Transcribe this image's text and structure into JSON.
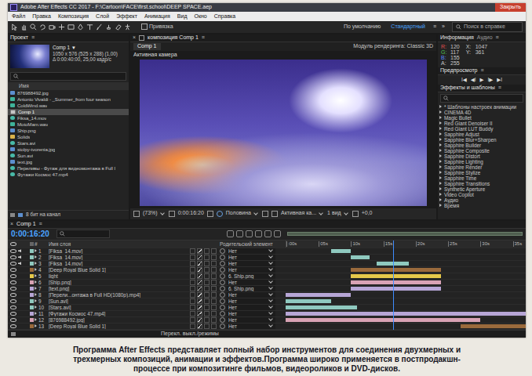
{
  "window": {
    "title": "Adobe After Effects CC 2017 - F:\\Cartoon\\FACE\\first.school\\DEEP SPACE.aep",
    "close_button": "Закрыть"
  },
  "menu": [
    "Файл",
    "Правка",
    "Композиция",
    "Слой",
    "Эффект",
    "Анимация",
    "Вид",
    "Окно",
    "Справка"
  ],
  "toolbar": {
    "snap": {
      "label": "Привязка",
      "checked": false
    },
    "workspaces": [
      {
        "label": "По умолчанию",
        "selected": false
      },
      {
        "label": "Стандартный",
        "selected": true
      }
    ],
    "menu_icon": "≡",
    "more": "»",
    "help_search": "Поиск в справке"
  },
  "project": {
    "title": "Проект",
    "menu_icon": "≡",
    "comp_name": "Comp 1 ▼",
    "comp_size": "1050 x 576 (525 x 288) (1,00)",
    "comp_duration": "Δ 0:00:40:00, 25,00 кадр/с",
    "column": "Имя",
    "items": [
      {
        "name": "876988492.jpg",
        "kind": "image",
        "selected": false
      },
      {
        "name": "Antonio Vivaldi - _Summer_from four season",
        "kind": "audio",
        "selected": false
      },
      {
        "name": "ColdWind.wav",
        "kind": "audio",
        "selected": false
      },
      {
        "name": "Comp 1",
        "kind": "comp",
        "selected": true
      },
      {
        "name": "Fiksa_14.mov",
        "kind": "video",
        "selected": false
      },
      {
        "name": "MotoMam.wav",
        "kind": "audio",
        "selected": false
      },
      {
        "name": "Ship.png",
        "kind": "image",
        "selected": false
      },
      {
        "name": "Solids",
        "kind": "folder",
        "selected": false
      },
      {
        "name": "Stars.avi",
        "kind": "video",
        "selected": false
      },
      {
        "name": "stolpy-tvorenia.jpg",
        "kind": "image",
        "selected": false
      },
      {
        "name": "Sun.avi",
        "kind": "video",
        "selected": false
      },
      {
        "name": "text.jpg",
        "kind": "image",
        "selected": false
      },
      {
        "name": "Переливы - Футаж для видеомонтажа в Full I",
        "kind": "video",
        "selected": false
      },
      {
        "name": "Футажи Космос 47.mp4",
        "kind": "video",
        "selected": false
      }
    ],
    "footer": "8 бит на канал"
  },
  "composition": {
    "close": "×",
    "title": "композиция Comp 1",
    "menu_icon": "≡",
    "tab": "Comp 1",
    "renderer": "Модуль рендеринга:  Classic 3D",
    "camera_label": "Активная камера",
    "zoom": "(73%)",
    "timecode": "0:00:16:20",
    "resolution": "Половина",
    "camera": "Активная ка...",
    "views": "1 вид",
    "exposure": "+0,0"
  },
  "info": {
    "tabs": [
      {
        "label": "Информация",
        "selected": true
      },
      {
        "label": "Аудио",
        "selected": false
      }
    ],
    "menu_icon": "≡",
    "channels": [
      {
        "label": "R:",
        "value": "120",
        "color": "#e05050"
      },
      {
        "label": "G:",
        "value": "117",
        "color": "#50c050"
      },
      {
        "label": "B:",
        "value": "155",
        "color": "#5a8cff"
      },
      {
        "label": "A:",
        "value": "255",
        "color": "#c8c8c8"
      }
    ],
    "coords": [
      {
        "label": "X:",
        "value": "1047"
      },
      {
        "label": "Y:",
        "value": "361"
      }
    ]
  },
  "preview": {
    "title": "Предпросмотр",
    "menu_icon": "≡",
    "controls": [
      "I◀",
      "◀I",
      "▶",
      "I▶",
      "▶I"
    ]
  },
  "effects": {
    "title": "Эффекты и шаблоны",
    "menu_icon": "≡",
    "items": [
      "* Шаблоны настроек анимации",
      "CINEMA 4D",
      "Magic Bullet",
      "Red Giant Denoiser II",
      "Red Giant LUT Buddy",
      "Sapphire Adjust",
      "Sapphire Blur+Sharpen",
      "Sapphire Builder",
      "Sapphire Composite",
      "Sapphire Distort",
      "Sapphire Lighting",
      "Sapphire Render",
      "Sapphire Stylize",
      "Sapphire Time",
      "Sapphire Transitions",
      "Synthetic Aperture",
      "Video Copilot",
      "Аудио",
      "Время"
    ]
  },
  "timeline": {
    "tab": "Comp 1",
    "menu_icon": "≡",
    "close": "×",
    "timecode": "0:00:16:20",
    "columns": [
      "#",
      "Имя слоя",
      "Родительский элемент"
    ],
    "ruler": [
      ":00s",
      "05s",
      "10s",
      "15s",
      "20s",
      "25s",
      "30s",
      "35s"
    ],
    "playhead": 16.8,
    "layers": [
      {
        "index": "1",
        "name": "[Fiksa_14.mov]",
        "parent": "Нет",
        "visible": true,
        "audio": true,
        "in": 7,
        "out": 10,
        "color": "#8fc9bf"
      },
      {
        "index": "2",
        "name": "[Fiksa_14.mov]",
        "parent": "Нет",
        "visible": true,
        "audio": true,
        "in": 10,
        "out": 13,
        "color": "#8fc9bf"
      },
      {
        "index": "3",
        "name": "[Fiksa_14.mov]",
        "parent": "Нет",
        "visible": true,
        "audio": true,
        "in": 14,
        "out": 19,
        "color": "#8fc9bf"
      },
      {
        "index": "4",
        "name": "[Deep Royal Blue Solid 1]",
        "parent": "Нет",
        "visible": true,
        "audio": false,
        "in": 10,
        "out": 24,
        "color": "#9a6a3c"
      },
      {
        "index": "5",
        "name": "light",
        "parent": "6. Ship.png",
        "visible": true,
        "audio": false,
        "in": 10,
        "out": 24,
        "color": "#e6c94a"
      },
      {
        "index": "6",
        "name": "[Ship.png]",
        "parent": "Нет",
        "visible": true,
        "audio": false,
        "in": 10,
        "out": 24,
        "color": "#d8a2b4"
      },
      {
        "index": "7",
        "name": "[text.png]",
        "parent": "6. Ship.png",
        "visible": true,
        "audio": false,
        "in": 10,
        "out": 24,
        "color": "#b7a6d6"
      },
      {
        "index": "8",
        "name": "[Перели...онтажа в Full HD(1080p).mp4]",
        "parent": "Нет",
        "visible": true,
        "audio": false,
        "in": 0,
        "out": 10,
        "color": "#b7a6d6"
      },
      {
        "index": "9",
        "name": "[Sun.avi]",
        "parent": "Нет",
        "visible": true,
        "audio": false,
        "in": 0,
        "out": 7,
        "color": "#8fc9bf"
      },
      {
        "index": "10",
        "name": "[Stars.avi]",
        "parent": "Нет",
        "visible": true,
        "audio": false,
        "in": 0,
        "out": 11,
        "color": "#8fc9bf"
      },
      {
        "index": "11",
        "name": "[Футажи Космос 47.mp4]",
        "parent": "Нет",
        "visible": true,
        "audio": false,
        "in": 0,
        "out": 37,
        "color": "#b7a6d6"
      },
      {
        "index": "12",
        "name": "[876988492.jpg]",
        "parent": "Нет",
        "visible": true,
        "audio": false,
        "in": 0,
        "out": 30,
        "color": "#d8a2b4"
      },
      {
        "index": "13",
        "name": "[Deep Royal Blue Solid 1]",
        "parent": "Нет",
        "visible": true,
        "audio": false,
        "in": 27,
        "out": 37,
        "color": "#9a6a3c"
      }
    ],
    "footer": "Перекл. выкл./режимы"
  },
  "caption": {
    "lines": [
      "Программа After Effects представляет полный набор инструментов для соединения двухмерных  и",
      "трехмерных композиций, анимации и эффектов.Программа широко применяется в постпродакшн-",
      "процессе при композитинге фильмов, видеороликов и DVD-дисков."
    ]
  }
}
